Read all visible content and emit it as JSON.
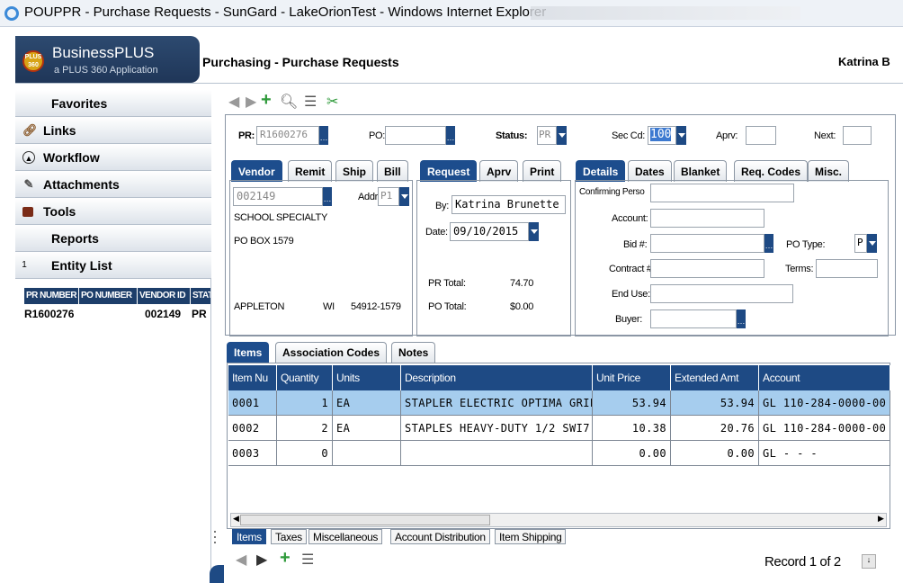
{
  "window": {
    "title": "POUPPR - Purchase Requests - SunGard - LakeOrionTest - Windows Internet Explorer"
  },
  "brand": {
    "logo_top": "PLUS",
    "logo_bottom": "360",
    "name": "BusinessPLUS",
    "tagline": "a PLUS 360 Application"
  },
  "header": {
    "app_title": "Purchasing - Purchase Requests",
    "user": "Katrina B"
  },
  "sidebar": {
    "items": [
      {
        "label": "Favorites",
        "icon": ""
      },
      {
        "label": "Links",
        "icon": "link-icon"
      },
      {
        "label": "Workflow",
        "icon": "workflow-icon"
      },
      {
        "label": "Attachments",
        "icon": "paperclip-icon"
      },
      {
        "label": "Tools",
        "icon": "toolbox-icon"
      },
      {
        "label": "Reports",
        "icon": ""
      },
      {
        "label": "Entity List",
        "icon": "",
        "count": "1"
      }
    ],
    "entity_list": {
      "headers": [
        "PR NUMBER",
        "PO NUMBER",
        "VENDOR ID",
        "STAT"
      ],
      "row": [
        "R1600276",
        "",
        "002149",
        "PR"
      ]
    }
  },
  "form": {
    "pr_label": "PR:",
    "pr_value": "R1600276",
    "po_label": "PO:",
    "po_value": "",
    "status_label": "Status:",
    "status_value": "PR",
    "seccd_label": "Sec Cd:",
    "seccd_value": "100",
    "aprv_label": "Aprv:",
    "aprv_value": "",
    "next_label": "Next:",
    "next_value": "",
    "vendor_tabs": [
      "Vendor",
      "Remit",
      "Ship",
      "Bill"
    ],
    "request_tabs": [
      "Request",
      "Aprv",
      "Print"
    ],
    "detail_tabs": [
      "Details",
      "Dates",
      "Blanket",
      "Req. Codes",
      "Misc."
    ],
    "vendor": {
      "id": "002149",
      "addr_label": "Addr:",
      "addr_value": "P1",
      "name": "SCHOOL SPECIALTY",
      "line1": "PO BOX 1579",
      "city": "APPLETON",
      "state": "WI",
      "zip": "54912-1579"
    },
    "request": {
      "by_label": "By:",
      "by_value": "Katrina Brunette",
      "date_label": "Date:",
      "date_value": "09/10/2015",
      "pr_total_label": "PR Total:",
      "pr_total_value": "74.70",
      "po_total_label": "PO Total:",
      "po_total_value": "$0.00"
    },
    "details": {
      "confirming_label": "Confirming Perso",
      "account_label": "Account:",
      "bid_label": "Bid #:",
      "contract_label": "Contract #:",
      "enduse_label": "End Use:",
      "buyer_label": "Buyer:",
      "potype_label": "PO Type:",
      "potype_value": "P",
      "terms_label": "Terms:"
    }
  },
  "items": {
    "tabs": [
      "Items",
      "Association Codes",
      "Notes"
    ],
    "columns": [
      "Item Nu",
      "Quantity",
      "Units",
      "Description",
      "Unit Price",
      "Extended Amt",
      "Account"
    ],
    "rows": [
      [
        "0001",
        "1",
        "EA",
        "STAPLER ELECTRIC OPTIMA GRIP",
        "53.94",
        "53.94",
        "GL 110-284-0000-00"
      ],
      [
        "0002",
        "2",
        "EA",
        "STAPLES HEAVY-DUTY 1/2 SWI7",
        "10.38",
        "20.76",
        "GL 110-284-0000-00"
      ],
      [
        "0003",
        "0",
        "",
        "",
        "0.00",
        "0.00",
        "GL   -   -   -"
      ]
    ],
    "bottom_tabs": [
      "Items",
      "Taxes",
      "Miscellaneous",
      "Account Distribution",
      "Item Shipping"
    ],
    "record": "Record 1 of 2"
  },
  "colors": {
    "header_blue": "#1e4a84",
    "selected_row": "#a6cdee"
  }
}
